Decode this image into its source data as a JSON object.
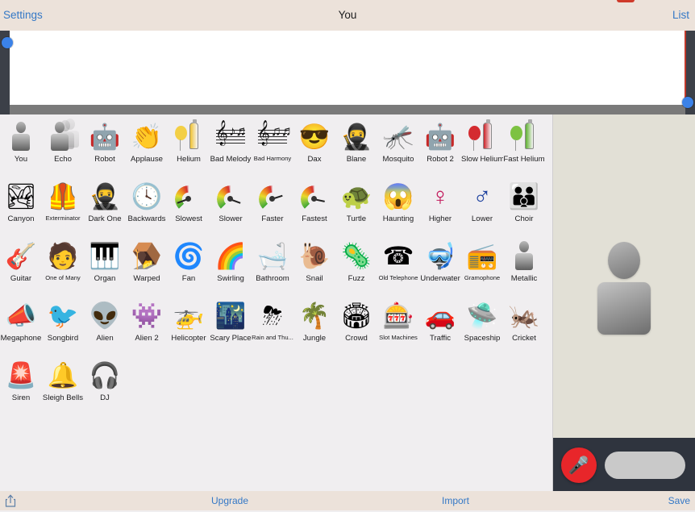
{
  "navbar": {
    "left_label": "Settings",
    "title": "You",
    "right_label": "List"
  },
  "timeline": {
    "playhead_color": "#c0392b",
    "handle_color": "#3b82e8",
    "scrollbar_color": "#7a7a7a"
  },
  "effects": [
    {
      "label": "You",
      "icon": "person-icon",
      "kind": "person"
    },
    {
      "label": "Echo",
      "icon": "person-echo-icon",
      "kind": "echo"
    },
    {
      "label": "Robot",
      "icon": "robot-icon",
      "kind": "emoji",
      "glyph": "🤖"
    },
    {
      "label": "Applause",
      "icon": "clapping-hands-icon",
      "kind": "emoji",
      "glyph": "👏"
    },
    {
      "label": "Helium",
      "icon": "helium-tank-icon",
      "kind": "balloon",
      "ball": "#f3cf45"
    },
    {
      "label": "Bad Melody",
      "icon": "music-staff-icon",
      "kind": "staff",
      "notes": "♪♬"
    },
    {
      "label": "Bad Harmony",
      "icon": "music-staff-icon",
      "kind": "staff",
      "notes": "♫♬",
      "small": true
    },
    {
      "label": "Dax",
      "icon": "face-sunglasses-icon",
      "kind": "emoji",
      "glyph": "😎"
    },
    {
      "label": "Blane",
      "icon": "masked-face-icon",
      "kind": "emoji",
      "glyph": "🥷"
    },
    {
      "label": "Mosquito",
      "icon": "mosquito-icon",
      "kind": "emoji",
      "glyph": "🦟"
    },
    {
      "label": "Robot 2",
      "icon": "robot-2-icon",
      "kind": "emoji",
      "glyph": "🤖"
    },
    {
      "label": "Slow Helium",
      "icon": "helium-tank-icon",
      "kind": "balloon",
      "ball": "#d42b30",
      "tank": "#cc2127"
    },
    {
      "label": "Fast Helium",
      "icon": "helium-tank-icon",
      "kind": "balloon",
      "ball": "#7dc242",
      "tank": "#5eb030"
    },
    {
      "label": "Canyon",
      "icon": "canyon-icon",
      "kind": "emoji",
      "glyph": "🏞"
    },
    {
      "label": "Exterminator",
      "icon": "dalek-icon",
      "kind": "emoji",
      "glyph": "🦺",
      "small": true
    },
    {
      "label": "Dark One",
      "icon": "dark-helmet-icon",
      "kind": "emoji",
      "glyph": "🥷"
    },
    {
      "label": "Backwards",
      "icon": "clock-icon",
      "kind": "emoji",
      "glyph": "🕓"
    },
    {
      "label": "Slowest",
      "icon": "gauge-icon",
      "kind": "gauge",
      "angle": 160
    },
    {
      "label": "Slower",
      "icon": "gauge-icon",
      "kind": "gauge",
      "angle": 20
    },
    {
      "label": "Faster",
      "icon": "gauge-icon",
      "kind": "gauge",
      "angle": -18
    },
    {
      "label": "Fastest",
      "icon": "gauge-icon",
      "kind": "gauge",
      "angle": 12
    },
    {
      "label": "Turtle",
      "icon": "turtle-icon",
      "kind": "emoji",
      "glyph": "🐢"
    },
    {
      "label": "Haunting",
      "icon": "ghost-mask-icon",
      "kind": "emoji",
      "glyph": "😱"
    },
    {
      "label": "Higher",
      "icon": "female-sign-icon",
      "kind": "female"
    },
    {
      "label": "Lower",
      "icon": "male-sign-icon",
      "kind": "male"
    },
    {
      "label": "Choir",
      "icon": "choir-icon",
      "kind": "emoji",
      "glyph": "👪"
    },
    {
      "label": "Guitar",
      "icon": "guitar-icon",
      "kind": "emoji",
      "glyph": "🎸"
    },
    {
      "label": "One of Many",
      "icon": "crowd-face-icon",
      "kind": "emoji",
      "glyph": "🧑",
      "small": true
    },
    {
      "label": "Organ",
      "icon": "organ-icon",
      "kind": "emoji",
      "glyph": "🎹"
    },
    {
      "label": "Warped",
      "icon": "warped-plank-icon",
      "kind": "emoji",
      "glyph": "🪤"
    },
    {
      "label": "Fan",
      "icon": "fan-icon",
      "kind": "emoji",
      "glyph": "🌀"
    },
    {
      "label": "Swirling",
      "icon": "swirl-icon",
      "kind": "emoji",
      "glyph": "🌈"
    },
    {
      "label": "Bathroom",
      "icon": "bathtub-icon",
      "kind": "emoji",
      "glyph": "🛁"
    },
    {
      "label": "Snail",
      "icon": "snail-icon",
      "kind": "emoji",
      "glyph": "🐌"
    },
    {
      "label": "Fuzz",
      "icon": "fuzz-virus-icon",
      "kind": "emoji",
      "glyph": "🦠"
    },
    {
      "label": "Old Telephone",
      "icon": "old-telephone-icon",
      "kind": "emoji",
      "glyph": "☎",
      "small": true
    },
    {
      "label": "Underwater",
      "icon": "diving-helmet-icon",
      "kind": "emoji",
      "glyph": "🤿"
    },
    {
      "label": "Gramophone",
      "icon": "gramophone-icon",
      "kind": "emoji",
      "glyph": "📻",
      "small": true
    },
    {
      "label": "Metallic",
      "icon": "metallic-person-icon",
      "kind": "person"
    },
    {
      "label": "Megaphone",
      "icon": "megaphone-icon",
      "kind": "emoji",
      "glyph": "📣"
    },
    {
      "label": "Songbird",
      "icon": "bird-icon",
      "kind": "emoji",
      "glyph": "🐦"
    },
    {
      "label": "Alien",
      "icon": "alien-icon",
      "kind": "emoji",
      "glyph": "👽"
    },
    {
      "label": "Alien 2",
      "icon": "alien-ufo-icon",
      "kind": "emoji",
      "glyph": "👾"
    },
    {
      "label": "Helicopter",
      "icon": "helicopter-icon",
      "kind": "emoji",
      "glyph": "🚁"
    },
    {
      "label": "Scary Place",
      "icon": "scary-place-icon",
      "kind": "emoji",
      "glyph": "🌃"
    },
    {
      "label": "Rain and Thu...",
      "icon": "storm-cloud-icon",
      "kind": "emoji",
      "glyph": "⛈",
      "small": true
    },
    {
      "label": "Jungle",
      "icon": "jungle-icon",
      "kind": "emoji",
      "glyph": "🌴"
    },
    {
      "label": "Crowd",
      "icon": "stadium-icon",
      "kind": "emoji",
      "glyph": "🏟"
    },
    {
      "label": "Slot Machines",
      "icon": "slot-machine-icon",
      "kind": "emoji",
      "glyph": "🎰",
      "small": true
    },
    {
      "label": "Traffic",
      "icon": "car-icon",
      "kind": "emoji",
      "glyph": "🚗"
    },
    {
      "label": "Spaceship",
      "icon": "ufo-icon",
      "kind": "emoji",
      "glyph": "🛸"
    },
    {
      "label": "Cricket",
      "icon": "cricket-icon",
      "kind": "emoji",
      "glyph": "🦗"
    },
    {
      "label": "Siren",
      "icon": "siren-icon",
      "kind": "emoji",
      "glyph": "🚨"
    },
    {
      "label": "Sleigh Bells",
      "icon": "sleigh-bells-icon",
      "kind": "emoji",
      "glyph": "🔔"
    },
    {
      "label": "DJ",
      "icon": "dj-icon",
      "kind": "emoji",
      "glyph": "🎧"
    }
  ],
  "recorder": {
    "record_icon": "microphone-icon",
    "record_glyph": "🎤",
    "record_color": "#e8262a",
    "pill_color": "#c9c9c9",
    "bar_color": "#2f343e"
  },
  "toolbar": {
    "share_icon": "share-export-icon",
    "upgrade_label": "Upgrade",
    "import_label": "Import",
    "save_label": "Save",
    "link_color": "#3478c6"
  }
}
